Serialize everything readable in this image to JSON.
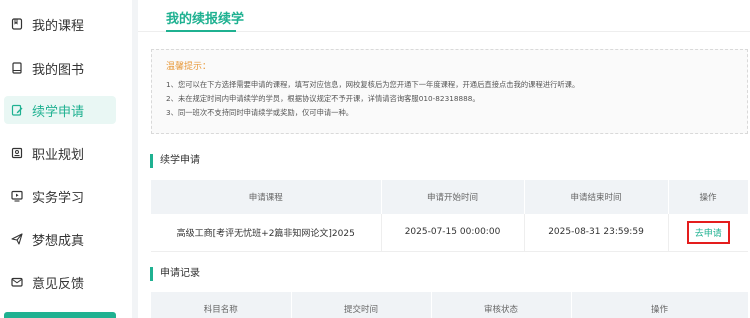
{
  "sidebar": {
    "items": [
      {
        "label": "我的课程",
        "icon": "bookmark-icon"
      },
      {
        "label": "我的图书",
        "icon": "book-icon"
      },
      {
        "label": "续学申请",
        "icon": "edit-document-icon",
        "active": true
      },
      {
        "label": "职业规划",
        "icon": "id-card-icon"
      },
      {
        "label": "实务学习",
        "icon": "monitor-play-icon"
      },
      {
        "label": "梦想成真",
        "icon": "paper-plane-icon"
      },
      {
        "label": "意见反馈",
        "icon": "feedback-mail-icon"
      }
    ]
  },
  "main": {
    "page_title": "我的续报续学",
    "tips": {
      "title": "温馨提示：",
      "items": [
        "1、您可以在下方选择需要申请的课程，填写对应信息，网校复核后为您开通下一年度课程，开通后直接点击我的课程进行听课。",
        "2、未在规定时间内申请续学的学员，根据协议规定不予开课，详情请咨询客服010-82318888。",
        "3、同一班次不支持同时申请续学或奖励，仅可申请一种。"
      ]
    },
    "apply_section": {
      "heading": "续学申请",
      "columns": [
        "申请课程",
        "申请开始时间",
        "申请结束时间",
        "操作"
      ],
      "rows": [
        {
          "course": "高级工商[考评无忧班+2篇非知网论文]2025",
          "start": "2025-07-15 00:00:00",
          "end": "2025-08-31 23:59:59",
          "action": "去申请"
        }
      ]
    },
    "records_section": {
      "heading": "申请记录",
      "columns": [
        "科目名称",
        "提交时间",
        "审核状态",
        "操作"
      ]
    }
  },
  "colors": {
    "accent": "#1fb191",
    "highlight_border": "#e41d1d",
    "tips_title": "#e89a3c"
  }
}
